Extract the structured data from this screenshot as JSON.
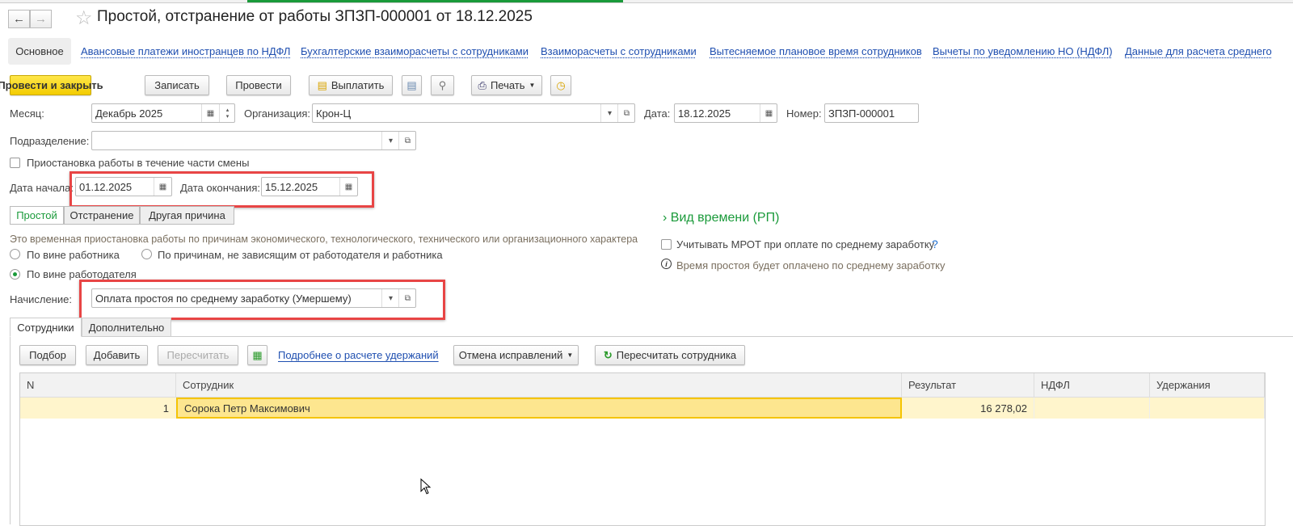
{
  "header": {
    "title": "Простой, отстранение от работы ЗПЗП-000001 от 18.12.2025",
    "back": "←",
    "forward": "→",
    "star": "☆"
  },
  "sections": {
    "active": "Основное",
    "links": [
      "Авансовые платежи иностранцев по НДФЛ",
      "Бухгалтерские взаиморасчеты с сотрудниками",
      "Взаиморасчеты с сотрудниками",
      "Вытесняемое плановое время сотрудников",
      "Вычеты по уведомлению НО (НДФЛ)",
      "Данные для расчета среднего"
    ]
  },
  "toolbar": {
    "post_close": "Провести и закрыть",
    "save": "Записать",
    "post": "Провести",
    "pay": "Выплатить",
    "print": "Печать"
  },
  "form": {
    "month_label": "Месяц:",
    "month": "Декабрь 2025",
    "org_label": "Организация:",
    "org": "Крон-Ц",
    "date_label": "Дата:",
    "date": "18.12.2025",
    "number_label": "Номер:",
    "number": "ЗПЗП-000001",
    "dept_label": "Подразделение:",
    "dept": "",
    "partial_shift": "Приостановка работы в течение части смены",
    "start_label": "Дата начала:",
    "start": "01.12.2025",
    "end_label": "Дата окончания:",
    "end": "15.12.2025",
    "kinds": [
      "Простой",
      "Отстранение",
      "Другая причина"
    ],
    "description": "Это временная приостановка работы по причинам экономического, технологического, технического или организационного характера",
    "radios": [
      "По вине работника",
      "По причинам, не зависящим от работодателя и работника",
      "По вине работодателя"
    ],
    "accrual_label": "Начисление:",
    "accrual": "Оплата простоя по среднему заработку (Умершему)",
    "time_kind": "Вид времени (РП)",
    "mrot": "Учитывать МРОТ при оплате по среднему заработку",
    "help": "?",
    "info": "Время простоя будет оплачено по среднему заработку"
  },
  "tabs": [
    "Сотрудники",
    "Дополнительно"
  ],
  "table_toolbar": {
    "pick": "Подбор",
    "add": "Добавить",
    "recalc": "Пересчитать",
    "link": "Подробнее о расчете удержаний",
    "cancel_fix": "Отмена исправлений",
    "recalc_emp": "Пересчитать сотрудника"
  },
  "table": {
    "columns": [
      "N",
      "Сотрудник",
      "Результат",
      "НДФЛ",
      "Удержания"
    ],
    "rows": [
      {
        "n": "1",
        "employee": "Сорока Петр Максимович",
        "result": "16 278,02",
        "ndfl": "",
        "deductions": ""
      }
    ]
  },
  "colors": {
    "accent_green": "#1a9a3a",
    "link": "#1f4fb0",
    "highlight": "#e84545",
    "primary": "#f3cc00"
  }
}
